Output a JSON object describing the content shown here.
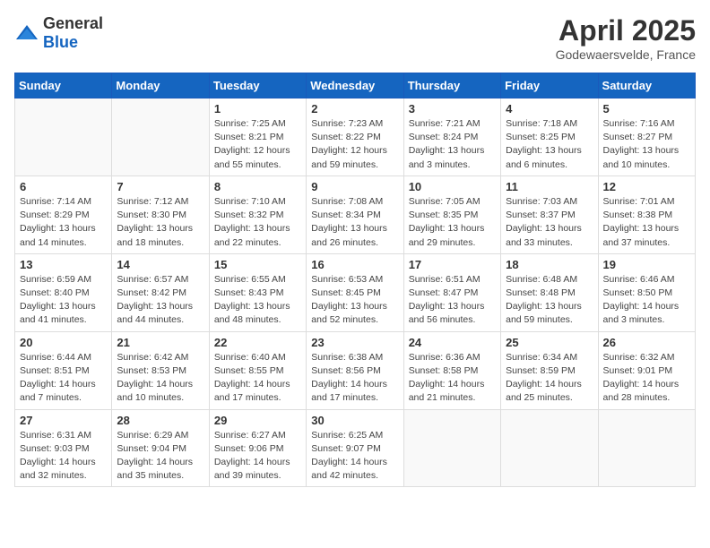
{
  "header": {
    "logo_general": "General",
    "logo_blue": "Blue",
    "month_title": "April 2025",
    "location": "Godewaersvelde, France"
  },
  "weekdays": [
    "Sunday",
    "Monday",
    "Tuesday",
    "Wednesday",
    "Thursday",
    "Friday",
    "Saturday"
  ],
  "weeks": [
    [
      {
        "day": "",
        "info": ""
      },
      {
        "day": "",
        "info": ""
      },
      {
        "day": "1",
        "info": "Sunrise: 7:25 AM\nSunset: 8:21 PM\nDaylight: 12 hours\nand 55 minutes."
      },
      {
        "day": "2",
        "info": "Sunrise: 7:23 AM\nSunset: 8:22 PM\nDaylight: 12 hours\nand 59 minutes."
      },
      {
        "day": "3",
        "info": "Sunrise: 7:21 AM\nSunset: 8:24 PM\nDaylight: 13 hours\nand 3 minutes."
      },
      {
        "day": "4",
        "info": "Sunrise: 7:18 AM\nSunset: 8:25 PM\nDaylight: 13 hours\nand 6 minutes."
      },
      {
        "day": "5",
        "info": "Sunrise: 7:16 AM\nSunset: 8:27 PM\nDaylight: 13 hours\nand 10 minutes."
      }
    ],
    [
      {
        "day": "6",
        "info": "Sunrise: 7:14 AM\nSunset: 8:29 PM\nDaylight: 13 hours\nand 14 minutes."
      },
      {
        "day": "7",
        "info": "Sunrise: 7:12 AM\nSunset: 8:30 PM\nDaylight: 13 hours\nand 18 minutes."
      },
      {
        "day": "8",
        "info": "Sunrise: 7:10 AM\nSunset: 8:32 PM\nDaylight: 13 hours\nand 22 minutes."
      },
      {
        "day": "9",
        "info": "Sunrise: 7:08 AM\nSunset: 8:34 PM\nDaylight: 13 hours\nand 26 minutes."
      },
      {
        "day": "10",
        "info": "Sunrise: 7:05 AM\nSunset: 8:35 PM\nDaylight: 13 hours\nand 29 minutes."
      },
      {
        "day": "11",
        "info": "Sunrise: 7:03 AM\nSunset: 8:37 PM\nDaylight: 13 hours\nand 33 minutes."
      },
      {
        "day": "12",
        "info": "Sunrise: 7:01 AM\nSunset: 8:38 PM\nDaylight: 13 hours\nand 37 minutes."
      }
    ],
    [
      {
        "day": "13",
        "info": "Sunrise: 6:59 AM\nSunset: 8:40 PM\nDaylight: 13 hours\nand 41 minutes."
      },
      {
        "day": "14",
        "info": "Sunrise: 6:57 AM\nSunset: 8:42 PM\nDaylight: 13 hours\nand 44 minutes."
      },
      {
        "day": "15",
        "info": "Sunrise: 6:55 AM\nSunset: 8:43 PM\nDaylight: 13 hours\nand 48 minutes."
      },
      {
        "day": "16",
        "info": "Sunrise: 6:53 AM\nSunset: 8:45 PM\nDaylight: 13 hours\nand 52 minutes."
      },
      {
        "day": "17",
        "info": "Sunrise: 6:51 AM\nSunset: 8:47 PM\nDaylight: 13 hours\nand 56 minutes."
      },
      {
        "day": "18",
        "info": "Sunrise: 6:48 AM\nSunset: 8:48 PM\nDaylight: 13 hours\nand 59 minutes."
      },
      {
        "day": "19",
        "info": "Sunrise: 6:46 AM\nSunset: 8:50 PM\nDaylight: 14 hours\nand 3 minutes."
      }
    ],
    [
      {
        "day": "20",
        "info": "Sunrise: 6:44 AM\nSunset: 8:51 PM\nDaylight: 14 hours\nand 7 minutes."
      },
      {
        "day": "21",
        "info": "Sunrise: 6:42 AM\nSunset: 8:53 PM\nDaylight: 14 hours\nand 10 minutes."
      },
      {
        "day": "22",
        "info": "Sunrise: 6:40 AM\nSunset: 8:55 PM\nDaylight: 14 hours\nand 17 minutes."
      },
      {
        "day": "23",
        "info": "Sunrise: 6:38 AM\nSunset: 8:56 PM\nDaylight: 14 hours\nand 17 minutes."
      },
      {
        "day": "24",
        "info": "Sunrise: 6:36 AM\nSunset: 8:58 PM\nDaylight: 14 hours\nand 21 minutes."
      },
      {
        "day": "25",
        "info": "Sunrise: 6:34 AM\nSunset: 8:59 PM\nDaylight: 14 hours\nand 25 minutes."
      },
      {
        "day": "26",
        "info": "Sunrise: 6:32 AM\nSunset: 9:01 PM\nDaylight: 14 hours\nand 28 minutes."
      }
    ],
    [
      {
        "day": "27",
        "info": "Sunrise: 6:31 AM\nSunset: 9:03 PM\nDaylight: 14 hours\nand 32 minutes."
      },
      {
        "day": "28",
        "info": "Sunrise: 6:29 AM\nSunset: 9:04 PM\nDaylight: 14 hours\nand 35 minutes."
      },
      {
        "day": "29",
        "info": "Sunrise: 6:27 AM\nSunset: 9:06 PM\nDaylight: 14 hours\nand 39 minutes."
      },
      {
        "day": "30",
        "info": "Sunrise: 6:25 AM\nSunset: 9:07 PM\nDaylight: 14 hours\nand 42 minutes."
      },
      {
        "day": "",
        "info": ""
      },
      {
        "day": "",
        "info": ""
      },
      {
        "day": "",
        "info": ""
      }
    ]
  ]
}
